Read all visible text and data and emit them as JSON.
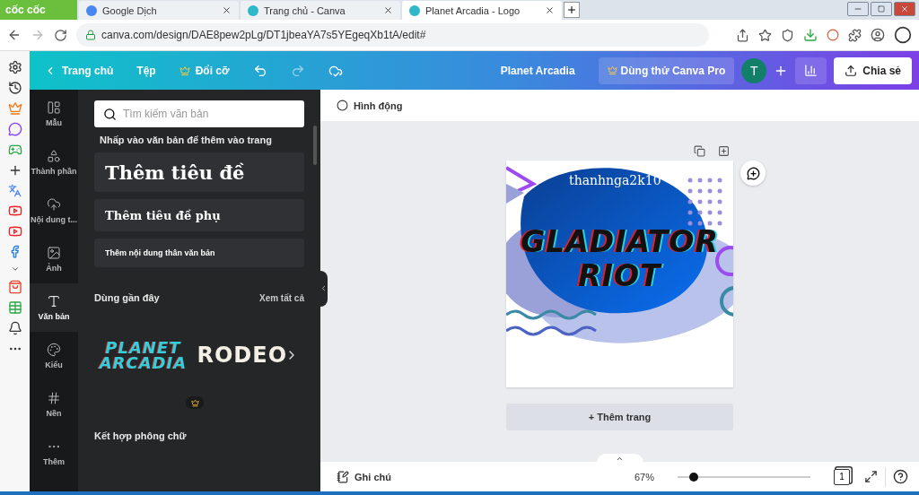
{
  "browser": {
    "brand": "cốc cốc",
    "tabs": [
      {
        "title": "Google Dịch",
        "selected": false
      },
      {
        "title": "Trang chủ - Canva",
        "selected": false
      },
      {
        "title": "Planet Arcadia - Logo",
        "selected": true
      }
    ],
    "address": "canva.com/design/DAE8pew2pLg/DT1jbeaYA7s5YEgeqXb1tA/edit#"
  },
  "header": {
    "home": "Trang chủ",
    "file": "Tệp",
    "resize": "Đổi cỡ",
    "design_title": "Planet Arcadia",
    "try_pro": "Dùng thử Canva Pro",
    "avatar": "T",
    "share": "Chia sẻ"
  },
  "nav": [
    {
      "label": "Mẫu",
      "selected": false
    },
    {
      "label": "Thành phần",
      "selected": false
    },
    {
      "label": "Nội dung t...",
      "selected": false
    },
    {
      "label": "Ảnh",
      "selected": false
    },
    {
      "label": "Văn bản",
      "selected": true
    },
    {
      "label": "Kiểu",
      "selected": false
    },
    {
      "label": "Nền",
      "selected": false
    },
    {
      "label": "Thêm",
      "selected": false
    }
  ],
  "panel": {
    "search": {
      "placeholder": "Tìm kiếm văn bản"
    },
    "hint": "Nhấp vào văn bản để thêm vào trang",
    "text_buttons": [
      {
        "label": "Thêm tiêu đề",
        "kind": "heading"
      },
      {
        "label": "Thêm tiêu đề phụ",
        "kind": "subheading"
      },
      {
        "label": "Thêm nội dung thân văn bản",
        "kind": "body"
      }
    ],
    "recent_title": "Dùng gần đây",
    "see_all": "Xem tất cả",
    "recent": [
      {
        "line1": "PLANET",
        "line2": "ARCADIA",
        "kind": "glitch"
      },
      {
        "line1": "RODEO",
        "kind": "serif"
      }
    ],
    "combos_title": "Kết hợp phông chữ"
  },
  "editor": {
    "animate": "Hình động",
    "page": {
      "watermark": "thanhnga2k10",
      "title_line1": "GLADIATOR",
      "title_line2": "RIOT"
    },
    "add_page": "+ Thêm trang"
  },
  "footer": {
    "notes": "Ghi chú",
    "zoom": "67%",
    "zoom_slider": {
      "level": 0.12
    },
    "page_count": "1"
  }
}
